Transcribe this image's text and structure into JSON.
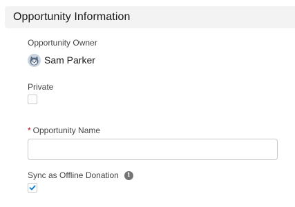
{
  "section": {
    "title": "Opportunity Information"
  },
  "owner": {
    "label": "Opportunity Owner",
    "name": "Sam Parker",
    "avatar_icon": "user-avatar-icon"
  },
  "private_field": {
    "label": "Private",
    "checked": false
  },
  "opportunity_name": {
    "required_marker": "*",
    "label": "Opportunity Name",
    "value": "",
    "placeholder": ""
  },
  "sync_offline": {
    "label": "Sync as Offline Donation",
    "info_icon": "info-icon",
    "info_glyph": "i",
    "checked": true
  },
  "colors": {
    "header_bg": "#f3f3f3",
    "check_accent": "#0176d3",
    "required": "#ba0517"
  }
}
